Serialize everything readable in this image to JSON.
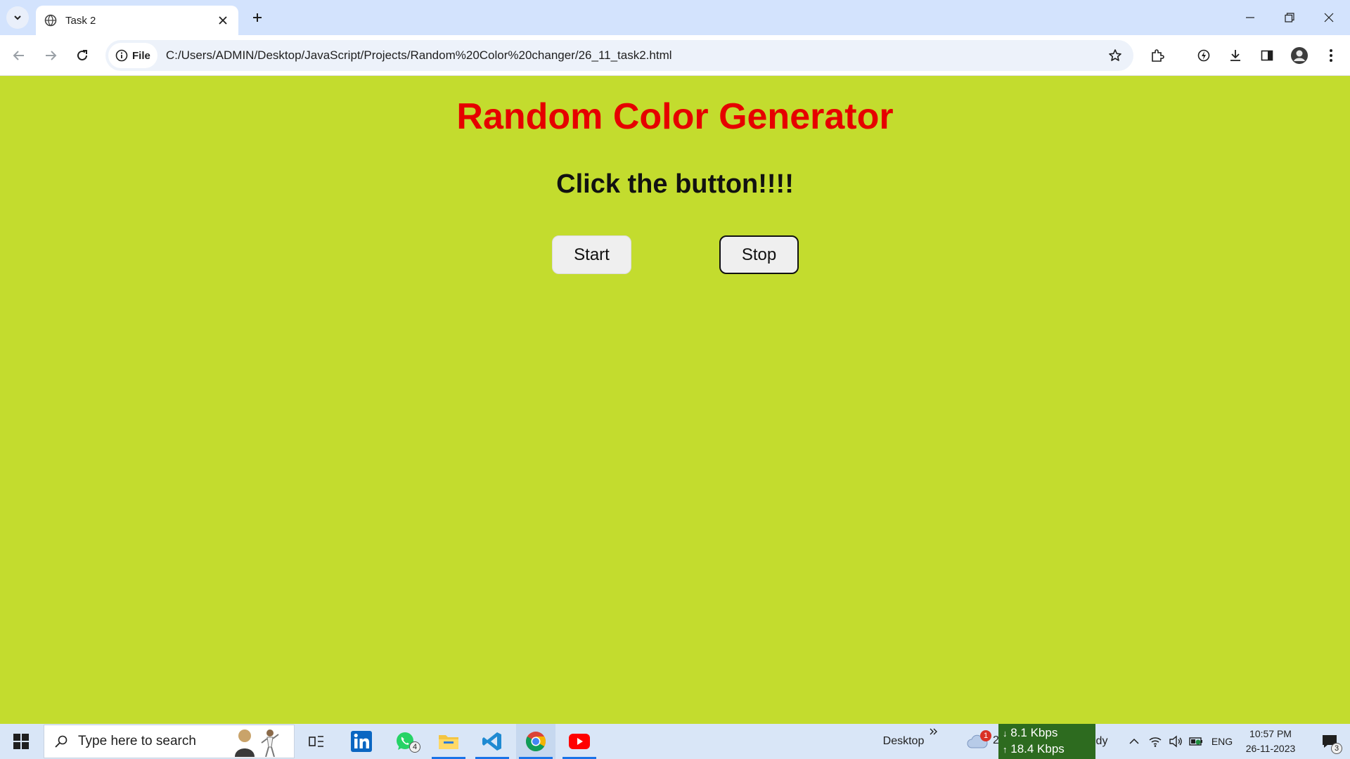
{
  "browser": {
    "tab_title": "Task 2",
    "site_chip_label": "File",
    "url": "C:/Users/ADMIN/Desktop/JavaScript/Projects/Random%20Color%20changer/26_11_task2.html",
    "icons": [
      "tab-list-icon",
      "globe-icon",
      "close-icon",
      "plus-icon",
      "minimize-icon",
      "restore-icon",
      "close-window-icon",
      "back-icon",
      "forward-icon",
      "reload-icon",
      "info-icon",
      "star-icon",
      "extensions-icon",
      "performance-icon",
      "download-icon",
      "side-panel-icon",
      "profile-icon",
      "menu-icon"
    ]
  },
  "page": {
    "background_color": "#c3dc2e",
    "heading": "Random Color Generator",
    "heading_color": "#e60000",
    "subheading": "Click the button!!!!",
    "start_label": "Start",
    "stop_label": "Stop"
  },
  "taskbar": {
    "search_placeholder": "Type here to search",
    "whatsapp_badge": "4",
    "desktop_label": "Desktop",
    "weather_badge": "1",
    "weather_fragment": "2",
    "net_down": "8.1 Kbps",
    "net_up": "18.4 Kbps",
    "weather_text_fragment": "dy",
    "language": "ENG",
    "time": "10:57 PM",
    "date": "26-11-2023",
    "notification_count": "3",
    "apps": [
      "task-view",
      "linkedin",
      "whatsapp",
      "file-explorer",
      "vscode",
      "chrome",
      "youtube"
    ]
  }
}
